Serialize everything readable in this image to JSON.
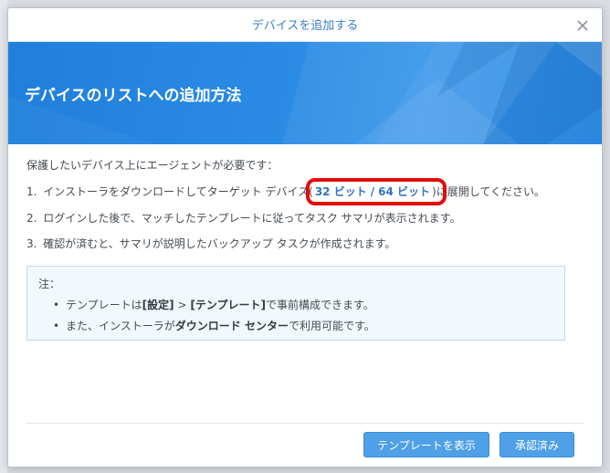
{
  "dialog": {
    "title": "デバイスを追加する",
    "banner_heading": "デバイスのリストへの追加方法"
  },
  "content": {
    "intro": "保護したいデバイス上にエージェントが必要です：",
    "step1": {
      "prefix": "1.",
      "text_before": "インストーラをダウンロードしてターゲット デバイス",
      "open_paren": "(",
      "link_32": "32 ビット",
      "slash": "/",
      "link_64": "64 ビット",
      "close_paren": ")",
      "text_after": "に展開してください。"
    },
    "step2": {
      "prefix": "2.",
      "text": "ログインした後で、マッチしたテンプレートに従ってタスク サマリが表示されます。"
    },
    "step3": {
      "prefix": "3.",
      "text": "確認が済むと、サマリが説明したバックアップ タスクが作成されます。"
    }
  },
  "note": {
    "label": "注：",
    "items": [
      {
        "bullet": "•",
        "p1": "テンプレートは",
        "b1": "[設定]",
        "p2": " > ",
        "b2": "[テンプレート]",
        "p3": "で事前構成できます。"
      },
      {
        "bullet": "•",
        "p1": "また、インストーラが",
        "b1": "ダウンロード センター",
        "p2": "で利用可能です。"
      }
    ]
  },
  "buttons": {
    "show_template": "テンプレートを表示",
    "approved": "承認済み"
  },
  "colors": {
    "accent": "#3e80c4",
    "banner": "#2a8ae4",
    "button": "#4fa0e6",
    "highlight": "#e30d0d"
  }
}
